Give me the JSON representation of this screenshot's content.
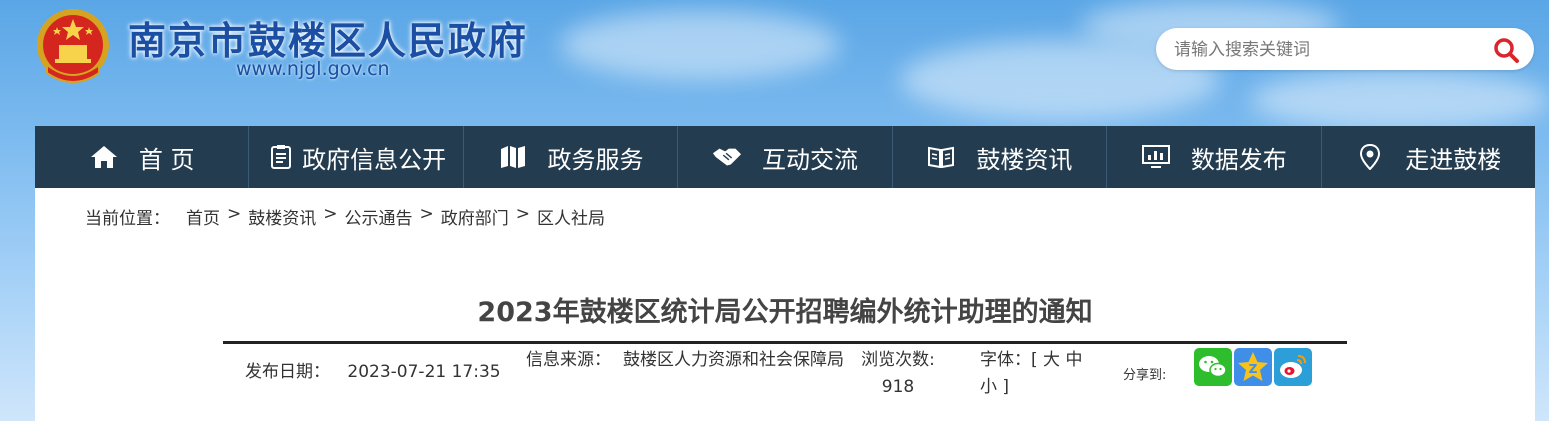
{
  "header": {
    "site_title": "南京市鼓楼区人民政府",
    "site_url": "www.njgl.gov.cn",
    "logo_icon": "national-emblem-icon"
  },
  "search": {
    "placeholder": "请输入搜索关键词",
    "icon": "search-icon"
  },
  "nav": {
    "items": [
      {
        "label": "首 页",
        "icon": "home-icon"
      },
      {
        "label": "政府信息公开",
        "icon": "document-icon"
      },
      {
        "label": "政务服务",
        "icon": "map-icon"
      },
      {
        "label": "互动交流",
        "icon": "handshake-icon"
      },
      {
        "label": "鼓楼资讯",
        "icon": "book-icon"
      },
      {
        "label": "数据发布",
        "icon": "monitor-chart-icon"
      },
      {
        "label": "走进鼓楼",
        "icon": "location-pin-icon"
      }
    ]
  },
  "breadcrumb": {
    "label": "当前位置：",
    "items": [
      "首页",
      "鼓楼资讯",
      "公示通告",
      "政府部门",
      "区人社局"
    ],
    "separator": ">"
  },
  "article": {
    "title": "2023年鼓楼区统计局公开招聘编外统计助理的通知",
    "publish_label": "发布日期：",
    "publish_date": "2023-07-21 17:35",
    "source_label": "信息来源：",
    "source_value": "鼓楼区人力资源和社会保障局",
    "views_label": "浏览次数:",
    "views_count": "918",
    "font_label": "字体：[",
    "font_large": "大",
    "font_medium": "中",
    "font_small": "小",
    "font_end": "]",
    "share_label": "分享到:"
  },
  "share": [
    "wechat-icon",
    "qzone-icon",
    "weibo-icon"
  ],
  "colors": {
    "nav_bg": "#243c4f",
    "title_blue": "#1a4fa3"
  }
}
